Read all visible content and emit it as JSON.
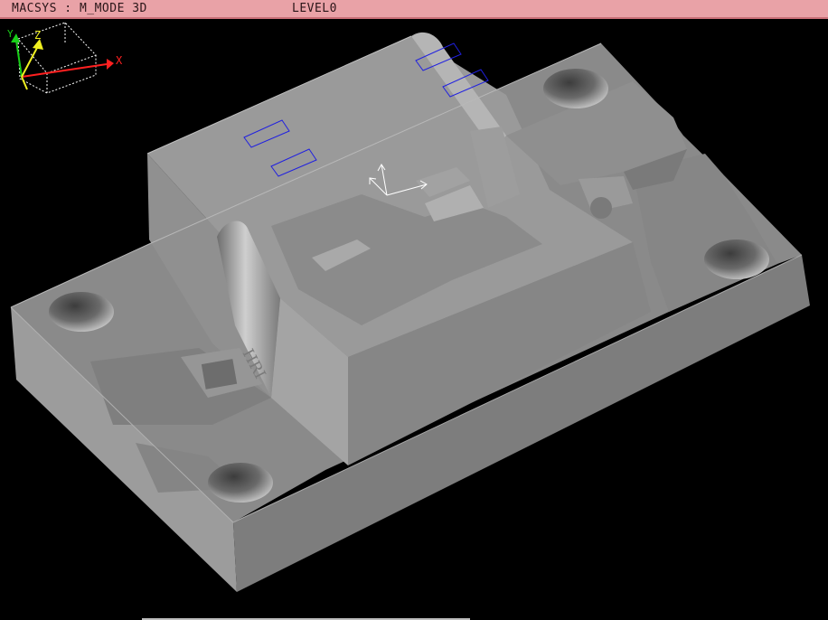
{
  "titlebar": {
    "system": "MACSYS : M_MODE 3D",
    "level": "LEVEL0"
  },
  "viewport": {
    "background": "#000000",
    "model_color": "#8e8e8e"
  },
  "triad": {
    "labels": {
      "x": "X",
      "y": "Y",
      "z": "Z"
    },
    "colors": {
      "x": "#ff2020",
      "y": "#18d018",
      "z": "#f0f020"
    }
  },
  "engraving": "HRI",
  "icons": {
    "workplane_axes": "axes-icon",
    "origin_triad": "coordinate-triad-icon"
  }
}
